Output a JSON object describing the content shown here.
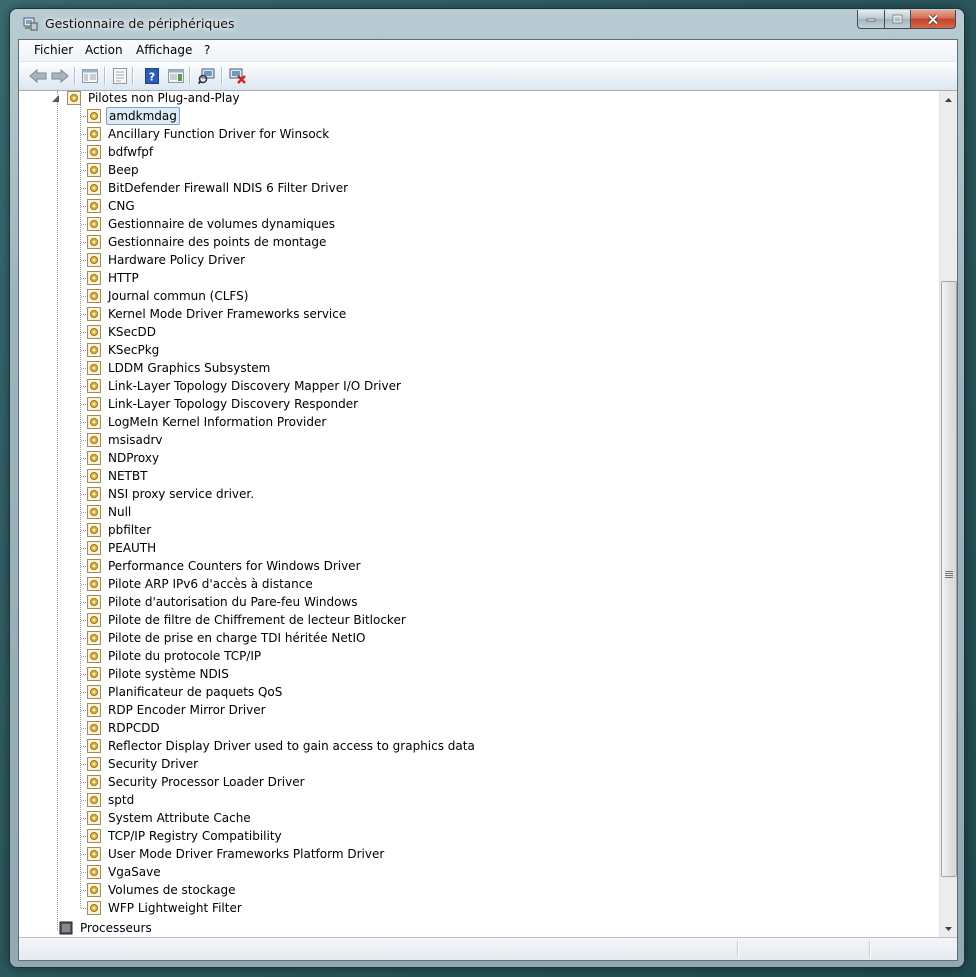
{
  "window": {
    "title": "Gestionnaire de périphériques"
  },
  "menu": [
    "Fichier",
    "Action",
    "Affichage",
    "?"
  ],
  "toolbar": {
    "buttons": [
      "back-icon",
      "forward-icon",
      "show-hide-console-tree-icon",
      "properties-icon",
      "help-icon",
      "action-pane-icon",
      "scan-hardware-icon",
      "uninstall-device-icon"
    ]
  },
  "tree": {
    "parent": "Pilotes non Plug-and-Play",
    "items": [
      "amdkmdag",
      "Ancillary Function Driver for Winsock",
      "bdfwfpf",
      "Beep",
      "BitDefender Firewall NDIS 6 Filter Driver",
      "CNG",
      "Gestionnaire de volumes dynamiques",
      "Gestionnaire des points de montage",
      "Hardware Policy Driver",
      "HTTP",
      "Journal commun (CLFS)",
      "Kernel Mode Driver Frameworks service",
      "KSecDD",
      "KSecPkg",
      "LDDM Graphics Subsystem",
      "Link-Layer Topology Discovery Mapper I/O Driver",
      "Link-Layer Topology Discovery Responder",
      "LogMeIn Kernel Information Provider",
      "msisadrv",
      "NDProxy",
      "NETBT",
      "NSI proxy service driver.",
      "Null",
      "pbfilter",
      "PEAUTH",
      "Performance Counters for Windows Driver",
      "Pilote ARP IPv6 d'accès à distance",
      "Pilote d'autorisation du Pare-feu Windows",
      "Pilote de filtre de Chiffrement de lecteur Bitlocker",
      "Pilote de prise en charge TDI héritée NetIO",
      "Pilote du protocole TCP/IP",
      "Pilote système NDIS",
      "Planificateur de paquets QoS",
      "RDP Encoder Mirror Driver",
      "RDPCDD",
      "Reflector Display Driver used to gain access to graphics data",
      "Security Driver",
      "Security Processor Loader Driver",
      "sptd",
      "System Attribute Cache",
      "TCP/IP Registry Compatibility",
      "User Mode Driver Frameworks Platform Driver",
      "VgaSave",
      "Volumes de stockage",
      "WFP Lightweight Filter"
    ],
    "next_category": "Processeurs",
    "selected_index": 0
  }
}
